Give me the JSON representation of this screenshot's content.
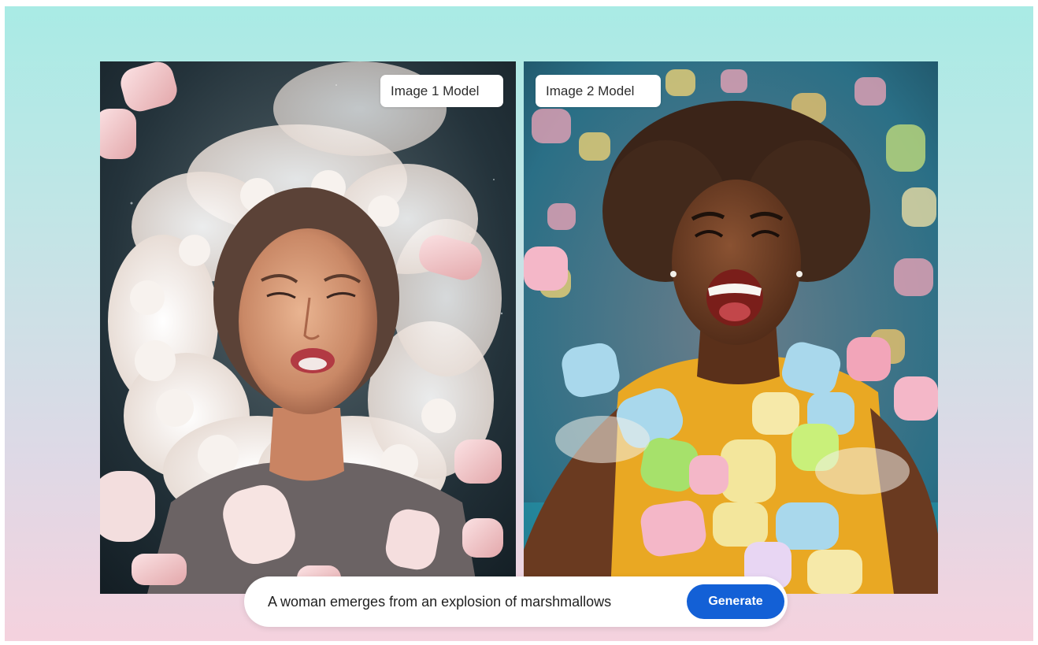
{
  "comparison": {
    "left": {
      "label": "Image 1 Model",
      "image": "photo-woman-emerging-from-marshmallow-cloud"
    },
    "right": {
      "label": "Image 2 Model",
      "image": "photo-laughing-woman-in-yellow-shirt-with-flying-marshmallows"
    }
  },
  "prompt": {
    "text": "A woman emerges from an explosion of marshmallows",
    "generate_label": "Generate"
  },
  "colors": {
    "background_top": "#a9ebe5",
    "background_bottom": "#f5d2de",
    "button": "#1360d6",
    "label_background": "#ffffff"
  }
}
